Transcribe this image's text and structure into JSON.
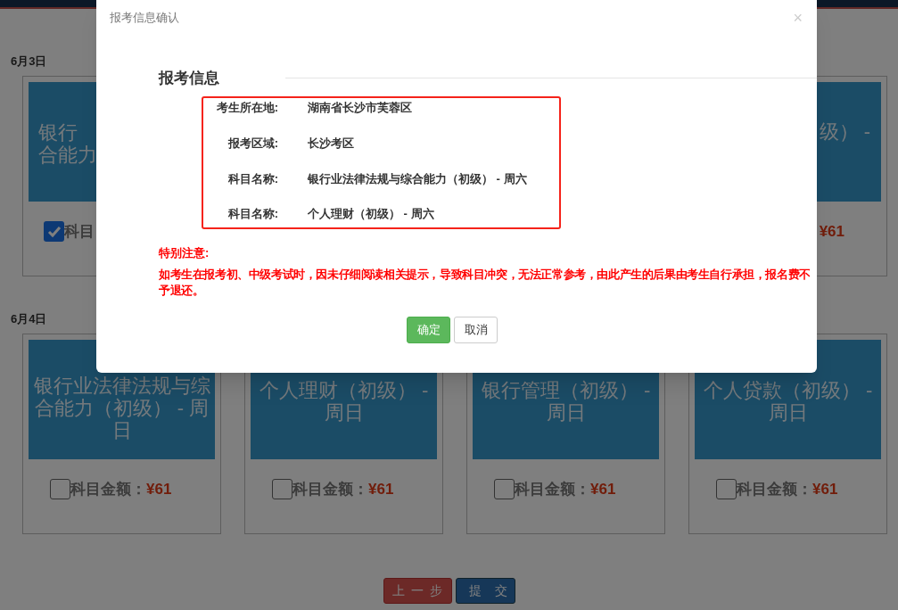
{
  "sections": [
    {
      "date": "6月3日",
      "cards": [
        {
          "kind": "left_fragment",
          "title_lines": [
            "银行",
            "合能力"
          ],
          "checked": true,
          "price_label": "科目"
        },
        {
          "kind": "covered"
        },
        {
          "kind": "covered"
        },
        {
          "kind": "right_fragment",
          "title_lines": [
            "级） -"
          ],
          "price": "¥61"
        }
      ]
    },
    {
      "date": "6月4日",
      "cards": [
        {
          "kind": "card",
          "title_lines": [
            "银行业法律法规与综",
            "合能力（初级） - 周",
            "日"
          ],
          "checked": false,
          "price_label": "科目金额：",
          "price": "¥61"
        },
        {
          "kind": "card",
          "title_lines": [
            "个人理财（初级） -",
            "周日"
          ],
          "checked": false,
          "price_label": "科目金额：",
          "price": "¥61"
        },
        {
          "kind": "card",
          "title_lines": [
            "银行管理（初级） -",
            "周日"
          ],
          "checked": false,
          "price_label": "科目金额：",
          "price": "¥61"
        },
        {
          "kind": "card",
          "title_lines": [
            "个人贷款（初级） -",
            "周日"
          ],
          "checked": false,
          "price_label": "科目金额：",
          "price": "¥61"
        }
      ]
    }
  ],
  "footer_buttons": [
    {
      "label": "上一步",
      "kind": "back"
    },
    {
      "label": "提交",
      "kind": "submit"
    }
  ],
  "dialog": {
    "title": "报考信息确认",
    "close": "×",
    "heading": "报考信息",
    "fields": [
      {
        "label": "考生所在地:",
        "value": "湖南省长沙市芙蓉区"
      },
      {
        "label": "报考区域:",
        "value": "长沙考区"
      },
      {
        "label": "科目名称:",
        "value": "银行业法律法规与综合能力（初级） - 周六"
      },
      {
        "label": "科目名称:",
        "value": "个人理财（初级） - 周六"
      }
    ],
    "notice_title": "特别注意:",
    "notice": "如考生在报考初、中级考试时，因未仔细阅读相关提示，导致科目冲突，无法正常参考，由此产生的后果由考生自行承担，报名费不予退还。",
    "buttons": [
      {
        "label": "确定",
        "kind": "primary"
      },
      {
        "label": "取消",
        "kind": "default"
      }
    ]
  }
}
